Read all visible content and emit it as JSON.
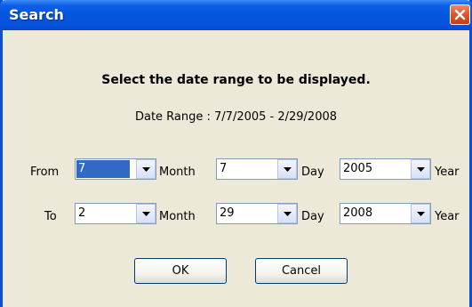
{
  "window": {
    "title": "Search"
  },
  "heading": "Select the date range to be displayed.",
  "date_range_text": "Date Range : 7/7/2005 - 2/29/2008",
  "from_row": {
    "label": "From",
    "month_value": "7",
    "month_label": "Month",
    "day_value": "7",
    "day_label": "Day",
    "year_value": "2005",
    "year_label": "Year"
  },
  "to_row": {
    "label": "To",
    "month_value": "2",
    "month_label": "Month",
    "day_value": "29",
    "day_label": "Day",
    "year_value": "2008",
    "year_label": "Year"
  },
  "buttons": {
    "ok": "OK",
    "cancel": "Cancel"
  },
  "icons": {
    "close": "close-icon",
    "dropdown": "chevron-down-icon"
  },
  "colors": {
    "titlebar": "#0356dc",
    "close_button": "#e2572e",
    "selection": "#316ac5",
    "dialog_background": "#ece9d8"
  }
}
